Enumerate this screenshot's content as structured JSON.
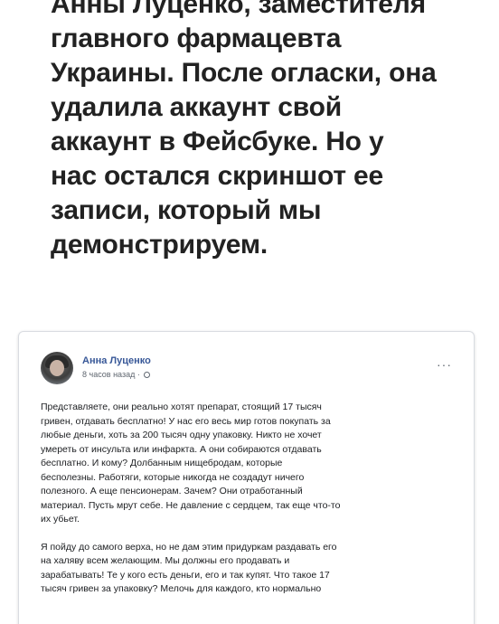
{
  "headline": {
    "lines": [
      "Анны Луценко, заместителя",
      "главного фармацевта",
      "Украины. После огласки, она",
      "удалила аккаунт свой",
      "аккаунт в Фейсбуке. Но у",
      "нас остался скриншот ее",
      "записи, который мы",
      "демонстрируем."
    ]
  },
  "post": {
    "author": "Анна Луценко",
    "time": "8 часов назад ·",
    "more_icon": "···",
    "icons": {
      "avatar": "avatar",
      "privacy": "globe-icon",
      "more": "more-icon"
    },
    "paragraph1": [
      "Представляете, они реально хотят препарат, стоящий 17 тысяч",
      "гривен, отдавать бесплатно! У нас его весь мир готов покупать за",
      "любые деньги, хоть за 200 тысяч одну упаковку. Никто не хочет",
      "умереть от инсульта или инфаркта. А они собираются отдавать",
      "бесплатно. И кому? Долбанным нищебродам, которые",
      "бесполезны. Работяги, которые никогда не создадут ничего",
      "полезного. А еще пенсионерам. Зачем? Они отработанный",
      "материал. Пусть мрут себе. Не давление с сердцем, так еще что-то",
      "их убьет."
    ],
    "paragraph2": [
      "Я пойду до самого верха, но не дам этим придуркам раздавать его",
      "на халяву всем желающим. Мы должны его продавать и",
      "зарабатывать! Те у кого есть деньги, его и так купят. Что такое 17",
      "тысяч гривен за упаковку? Мелочь для каждого, кто нормально"
    ]
  }
}
